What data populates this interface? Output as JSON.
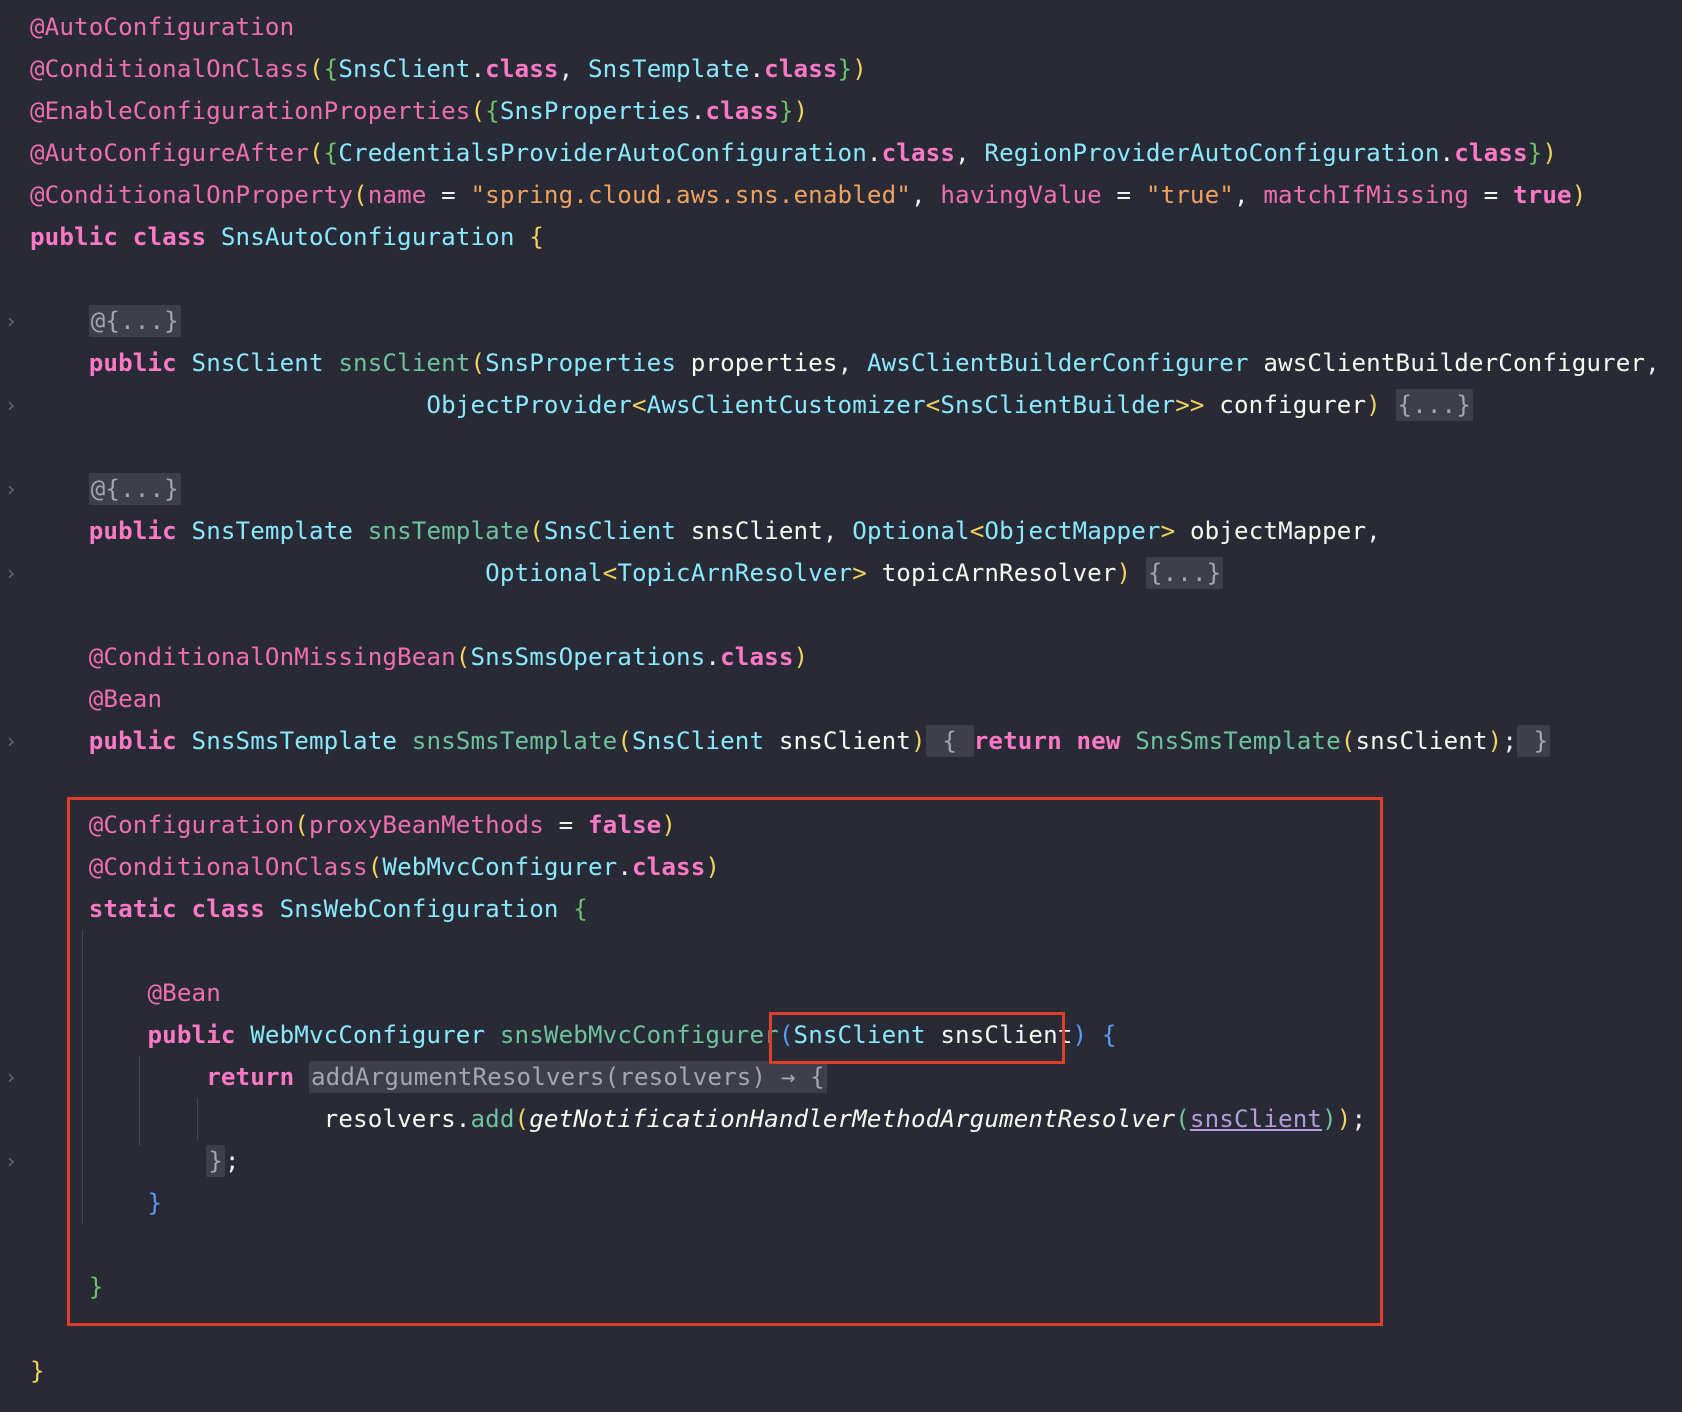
{
  "editor": {
    "lines": [
      {
        "segs": [
          [
            "ann",
            "@AutoConfiguration"
          ]
        ]
      },
      {
        "segs": [
          [
            "ann",
            "@ConditionalOnClass"
          ],
          [
            "par",
            "("
          ],
          [
            "brk",
            "{"
          ],
          [
            "type",
            "SnsClient"
          ],
          [
            "pun",
            "."
          ],
          [
            "kw",
            "class"
          ],
          [
            "pun",
            ", "
          ],
          [
            "type",
            "SnsTemplate"
          ],
          [
            "pun",
            "."
          ],
          [
            "kw",
            "class"
          ],
          [
            "brk",
            "}"
          ],
          [
            "par",
            ")"
          ]
        ]
      },
      {
        "segs": [
          [
            "ann",
            "@EnableConfigurationProperties"
          ],
          [
            "par",
            "("
          ],
          [
            "brk",
            "{"
          ],
          [
            "type",
            "SnsProperties"
          ],
          [
            "pun",
            "."
          ],
          [
            "kw",
            "class"
          ],
          [
            "brk",
            "}"
          ],
          [
            "par",
            ")"
          ]
        ]
      },
      {
        "segs": [
          [
            "ann",
            "@AutoConfigureAfter"
          ],
          [
            "par",
            "("
          ],
          [
            "brk",
            "{"
          ],
          [
            "type",
            "CredentialsProviderAutoConfiguration"
          ],
          [
            "pun",
            "."
          ],
          [
            "kw",
            "class"
          ],
          [
            "pun",
            ", "
          ],
          [
            "type",
            "RegionProviderAutoConfiguration"
          ],
          [
            "pun",
            "."
          ],
          [
            "kw",
            "class"
          ],
          [
            "brk",
            "}"
          ],
          [
            "par",
            ")"
          ]
        ]
      },
      {
        "segs": [
          [
            "ann",
            "@ConditionalOnProperty"
          ],
          [
            "par",
            "("
          ],
          [
            "ann",
            "name"
          ],
          [
            "pun",
            " = "
          ],
          [
            "str",
            "\"spring.cloud.aws.sns.enabled\""
          ],
          [
            "pun",
            ", "
          ],
          [
            "ann",
            "havingValue"
          ],
          [
            "pun",
            " = "
          ],
          [
            "str",
            "\"true\""
          ],
          [
            "pun",
            ", "
          ],
          [
            "ann",
            "matchIfMissing"
          ],
          [
            "pun",
            " = "
          ],
          [
            "kw",
            "true"
          ],
          [
            "par",
            ")"
          ]
        ]
      },
      {
        "segs": [
          [
            "kw",
            "public class "
          ],
          [
            "type",
            "SnsAutoConfiguration"
          ],
          [
            "pun",
            " "
          ],
          [
            "par",
            "{"
          ]
        ]
      },
      {
        "segs": []
      },
      {
        "segs": [
          [
            "pun",
            "    "
          ],
          [
            "fold-box",
            "@{...}"
          ]
        ]
      },
      {
        "segs": [
          [
            "pun",
            "    "
          ],
          [
            "kw",
            "public "
          ],
          [
            "type",
            "SnsClient"
          ],
          [
            "pun",
            " "
          ],
          [
            "fn",
            "snsClient"
          ],
          [
            "par",
            "("
          ],
          [
            "type",
            "SnsProperties"
          ],
          [
            "id",
            " properties"
          ],
          [
            "pun",
            ", "
          ],
          [
            "type",
            "AwsClientBuilderConfigurer"
          ],
          [
            "id",
            " awsClientBuilderConfigurer"
          ],
          [
            "pun",
            ","
          ]
        ]
      },
      {
        "segs": [
          [
            "pun",
            "                           "
          ],
          [
            "type",
            "ObjectProvider"
          ],
          [
            "par",
            "<"
          ],
          [
            "type",
            "AwsClientCustomizer"
          ],
          [
            "par",
            "<"
          ],
          [
            "type",
            "SnsClientBuilder"
          ],
          [
            "par",
            ">>"
          ],
          [
            "id",
            " configurer"
          ],
          [
            "par",
            ")"
          ],
          [
            "pun",
            " "
          ],
          [
            "fold-box",
            "{...}"
          ]
        ]
      },
      {
        "segs": []
      },
      {
        "segs": [
          [
            "pun",
            "    "
          ],
          [
            "fold-box",
            "@{...}"
          ]
        ]
      },
      {
        "segs": [
          [
            "pun",
            "    "
          ],
          [
            "kw",
            "public "
          ],
          [
            "type",
            "SnsTemplate"
          ],
          [
            "pun",
            " "
          ],
          [
            "fn",
            "snsTemplate"
          ],
          [
            "par",
            "("
          ],
          [
            "type",
            "SnsClient"
          ],
          [
            "id",
            " snsClient"
          ],
          [
            "pun",
            ", "
          ],
          [
            "type",
            "Optional"
          ],
          [
            "par",
            "<"
          ],
          [
            "type",
            "ObjectMapper"
          ],
          [
            "par",
            ">"
          ],
          [
            "id",
            " objectMapper"
          ],
          [
            "pun",
            ","
          ]
        ]
      },
      {
        "segs": [
          [
            "pun",
            "                               "
          ],
          [
            "type",
            "Optional"
          ],
          [
            "par",
            "<"
          ],
          [
            "type",
            "TopicArnResolver"
          ],
          [
            "par",
            ">"
          ],
          [
            "id",
            " topicArnResolver"
          ],
          [
            "par",
            ")"
          ],
          [
            "pun",
            " "
          ],
          [
            "fold-box",
            "{...}"
          ]
        ]
      },
      {
        "segs": []
      },
      {
        "segs": [
          [
            "pun",
            "    "
          ],
          [
            "ann",
            "@ConditionalOnMissingBean"
          ],
          [
            "par",
            "("
          ],
          [
            "type",
            "SnsSmsOperations"
          ],
          [
            "pun",
            "."
          ],
          [
            "kw",
            "class"
          ],
          [
            "par",
            ")"
          ]
        ]
      },
      {
        "segs": [
          [
            "pun",
            "    "
          ],
          [
            "ann",
            "@Bean"
          ]
        ]
      },
      {
        "segs": [
          [
            "pun",
            "    "
          ],
          [
            "kw",
            "public "
          ],
          [
            "type",
            "SnsSmsTemplate"
          ],
          [
            "pun",
            " "
          ],
          [
            "fn",
            "snsSmsTemplate"
          ],
          [
            "par",
            "("
          ],
          [
            "type",
            "SnsClient"
          ],
          [
            "id",
            " snsClient"
          ],
          [
            "par",
            ")"
          ],
          [
            "fold-box",
            " { "
          ],
          [
            "kw",
            "return new "
          ],
          [
            "fn",
            "SnsSmsTemplate"
          ],
          [
            "par",
            "("
          ],
          [
            "id",
            "snsClient"
          ],
          [
            "par",
            ")"
          ],
          [
            "pun",
            ";"
          ],
          [
            "fold-box",
            " }"
          ]
        ]
      },
      {
        "segs": []
      },
      {
        "segs": [
          [
            "pun",
            "    "
          ],
          [
            "ann",
            "@Configuration"
          ],
          [
            "par",
            "("
          ],
          [
            "ann",
            "proxyBeanMethods"
          ],
          [
            "pun",
            " = "
          ],
          [
            "kw",
            "false"
          ],
          [
            "par",
            ")"
          ]
        ]
      },
      {
        "segs": [
          [
            "pun",
            "    "
          ],
          [
            "ann",
            "@ConditionalOnClass"
          ],
          [
            "par",
            "("
          ],
          [
            "type",
            "WebMvcConfigurer"
          ],
          [
            "pun",
            "."
          ],
          [
            "kw",
            "class"
          ],
          [
            "par",
            ")"
          ]
        ]
      },
      {
        "segs": [
          [
            "pun",
            "    "
          ],
          [
            "kw",
            "static class "
          ],
          [
            "type",
            "SnsWebConfiguration"
          ],
          [
            "pun",
            " "
          ],
          [
            "brk",
            "{"
          ]
        ]
      },
      {
        "segs": []
      },
      {
        "segs": [
          [
            "pun",
            "        "
          ],
          [
            "ann",
            "@Bean"
          ]
        ]
      },
      {
        "segs": [
          [
            "pun",
            "        "
          ],
          [
            "kw",
            "public "
          ],
          [
            "type",
            "WebMvcConfigurer"
          ],
          [
            "pun",
            " "
          ],
          [
            "fn",
            "snsWebMvcConfigurer"
          ],
          [
            "blue",
            "("
          ],
          [
            "type",
            "SnsClient"
          ],
          [
            "id",
            " snsClient"
          ],
          [
            "blue",
            ")"
          ],
          [
            "pun",
            " "
          ],
          [
            "blue",
            "{"
          ]
        ]
      },
      {
        "segs": [
          [
            "pun",
            "            "
          ],
          [
            "kw",
            "return "
          ],
          [
            "fold-box",
            "addArgumentResolvers(resolvers) → {"
          ]
        ]
      },
      {
        "segs": [
          [
            "pun",
            "                    "
          ],
          [
            "id",
            "resolvers"
          ],
          [
            "pun",
            "."
          ],
          [
            "fn",
            "add"
          ],
          [
            "par",
            "("
          ],
          [
            "ital",
            "getNotificationHandlerMethodArgumentResolver"
          ],
          [
            "fn",
            "("
          ],
          [
            "ul",
            "snsClient"
          ],
          [
            "fn",
            ")"
          ],
          [
            "par",
            ")"
          ],
          [
            "pun",
            ";"
          ]
        ]
      },
      {
        "segs": [
          [
            "pun",
            "            "
          ],
          [
            "fold-box",
            "}"
          ],
          [
            "pun",
            ";"
          ]
        ]
      },
      {
        "segs": [
          [
            "pun",
            "        "
          ],
          [
            "blue",
            "}"
          ]
        ]
      },
      {
        "segs": []
      },
      {
        "segs": [
          [
            "pun",
            "    "
          ],
          [
            "brk",
            "}"
          ]
        ]
      },
      {
        "segs": []
      },
      {
        "segs": [
          [
            "par",
            "}"
          ]
        ]
      }
    ]
  }
}
